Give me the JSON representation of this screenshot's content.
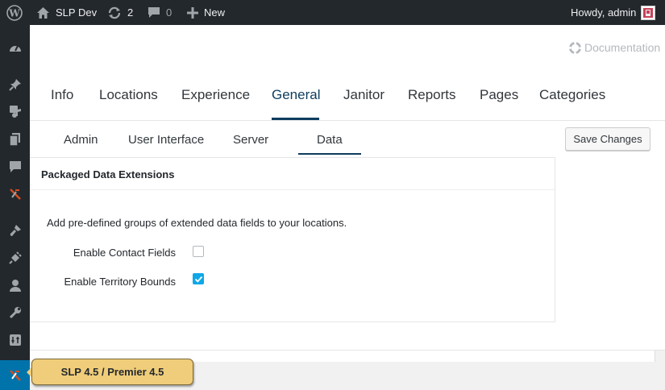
{
  "adminbar": {
    "site_name": "SLP Dev",
    "updates_count": "2",
    "comments_count": "0",
    "new_label": "New",
    "howdy": "Howdy, admin"
  },
  "documentation_label": "Documentation",
  "top_tabs": [
    "Info",
    "Locations",
    "Experience",
    "General",
    "Janitor",
    "Reports",
    "Pages",
    "Categories"
  ],
  "active_top_tab": "General",
  "sub_tabs": [
    "Admin",
    "User Interface",
    "Server",
    "Data"
  ],
  "active_sub_tab": "Data",
  "save_button": "Save Changes",
  "section": {
    "title": "Packaged Data Extensions",
    "description": "Add pre-defined groups of extended data fields to your locations.",
    "fields": [
      {
        "label": "Enable Contact Fields",
        "checked": false
      },
      {
        "label": "Enable Territory Bounds",
        "checked": true
      }
    ]
  },
  "version_badge": "SLP 4.5 / Premier 4.5",
  "colors": {
    "adminbar_bg": "#23282d",
    "accent": "#0073aa",
    "checkbox_checked": "#0fa8e6",
    "badge_bg": "#f0cd7a",
    "active_tab": "#0e3c5e"
  }
}
